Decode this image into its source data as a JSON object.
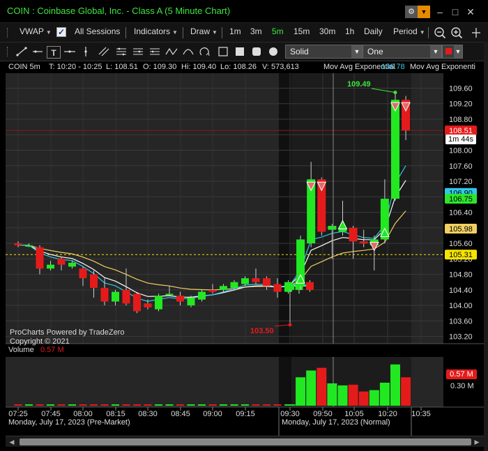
{
  "window": {
    "title": "COIN : Coinbase Global, Inc. - Class A (5 Minute Chart)"
  },
  "toolbar": {
    "vwap_label": "VWAP",
    "vwap_checked": true,
    "all_sessions_label": "All Sessions",
    "indicators_label": "Indicators",
    "draw_label": "Draw",
    "timeframes": [
      "1m",
      "3m",
      "5m",
      "15m",
      "30m",
      "1h",
      "Daily"
    ],
    "active_timeframe": "5m",
    "period_label": "Period"
  },
  "draw_toolbar": {
    "line_style": "Solid",
    "line_width": "One",
    "color": "#e51b1b"
  },
  "info_bar": {
    "symbol": "COIN 5m",
    "time": "T: 10:20 - 10:25",
    "last": "L: 108.51",
    "open": "O: 109.30",
    "high": "Hi: 109.40",
    "low": "Lo: 108.26",
    "volume": "V: 573,613",
    "ma1_label": "Mov Avg Exponential",
    "ma1_value": "106.78",
    "ma2_label": "Mov Avg Exponenti"
  },
  "chart": {
    "branding": "ProCharts Powered by TradeZero",
    "copyright": "Copyright © 2021",
    "high_marker": "109.49",
    "low_marker": "103.50",
    "volume_label": "Volume",
    "volume_value": "0.57 M",
    "volume_badge": "0.57 M",
    "volume_axis_label": "0.30 M",
    "countdown": "1m 44s",
    "date_premarket": "Monday, July 17, 2023 (Pre-Market)",
    "date_normal": "Monday, July 17, 2023 (Normal)",
    "price_badges": [
      {
        "text": "108.51",
        "bg": "#e51b1b",
        "fg": "#ffffff",
        "price": 108.51
      },
      {
        "text": "106.90",
        "bg": "#30c8e8",
        "fg": "#000000",
        "price": 106.9
      },
      {
        "text": "106.75",
        "bg": "#2ee52e",
        "fg": "#000000",
        "price": 106.75
      },
      {
        "text": "105.98",
        "bg": "#f0d060",
        "fg": "#000000",
        "price": 105.98
      },
      {
        "text": "105.31",
        "bg": "#f5e400",
        "fg": "#000000",
        "price": 105.31
      }
    ]
  },
  "chart_data": {
    "type": "candlestick",
    "price_axis": [
      "109.60",
      "109.20",
      "108.80",
      "108.40",
      "108.00",
      "107.60",
      "107.20",
      "106.80",
      "106.40",
      "106.00",
      "105.60",
      "105.20",
      "104.80",
      "104.40",
      "104.00",
      "103.60",
      "103.20"
    ],
    "ylim": [
      103.05,
      109.95
    ],
    "time_axis": [
      "07:25",
      "07:45",
      "08:00",
      "08:15",
      "08:30",
      "08:45",
      "09:00",
      "09:15",
      "09:30",
      "09:50",
      "10:05",
      "10:20",
      "10:35"
    ],
    "candles": [
      {
        "o": 105.6,
        "h": 105.65,
        "l": 105.5,
        "c": 105.55
      },
      {
        "o": 105.55,
        "h": 105.6,
        "l": 105.5,
        "c": 105.55
      },
      {
        "o": 105.5,
        "h": 105.55,
        "l": 104.8,
        "c": 104.95
      },
      {
        "o": 104.95,
        "h": 105.15,
        "l": 104.9,
        "c": 105.05
      },
      {
        "o": 105.2,
        "h": 105.25,
        "l": 104.9,
        "c": 105.05
      },
      {
        "o": 105.0,
        "h": 105.15,
        "l": 104.95,
        "c": 105.1
      },
      {
        "o": 104.95,
        "h": 105.0,
        "l": 104.5,
        "c": 104.7
      },
      {
        "o": 104.8,
        "h": 104.9,
        "l": 104.2,
        "c": 104.45
      },
      {
        "o": 104.45,
        "h": 104.7,
        "l": 104.0,
        "c": 104.1
      },
      {
        "o": 104.1,
        "h": 104.4,
        "l": 104.0,
        "c": 104.35
      },
      {
        "o": 104.4,
        "h": 104.95,
        "l": 104.0,
        "c": 104.05
      },
      {
        "o": 104.3,
        "h": 104.35,
        "l": 103.8,
        "c": 103.85
      },
      {
        "o": 104.05,
        "h": 104.15,
        "l": 103.9,
        "c": 103.95
      },
      {
        "o": 103.9,
        "h": 104.3,
        "l": 103.85,
        "c": 104.25
      },
      {
        "o": 104.3,
        "h": 104.5,
        "l": 104.25,
        "c": 104.3
      },
      {
        "o": 104.25,
        "h": 104.35,
        "l": 104.0,
        "c": 104.1
      },
      {
        "o": 104.0,
        "h": 104.25,
        "l": 103.95,
        "c": 104.2
      },
      {
        "o": 104.15,
        "h": 104.4,
        "l": 104.1,
        "c": 104.35
      },
      {
        "o": 104.4,
        "h": 104.55,
        "l": 104.3,
        "c": 104.35
      },
      {
        "o": 104.4,
        "h": 104.55,
        "l": 104.35,
        "c": 104.5
      },
      {
        "o": 104.45,
        "h": 104.65,
        "l": 104.4,
        "c": 104.6
      },
      {
        "o": 104.55,
        "h": 104.75,
        "l": 104.5,
        "c": 104.7
      },
      {
        "o": 104.7,
        "h": 104.95,
        "l": 104.55,
        "c": 104.6
      },
      {
        "o": 104.7,
        "h": 104.75,
        "l": 104.4,
        "c": 104.5
      },
      {
        "o": 104.55,
        "h": 104.7,
        "l": 104.2,
        "c": 104.35
      },
      {
        "o": 104.35,
        "h": 104.65,
        "l": 104.3,
        "c": 104.6
      },
      {
        "o": 104.4,
        "h": 104.7,
        "l": 104.3,
        "c": 104.65
      },
      {
        "o": 104.6,
        "h": 104.65,
        "l": 104.35,
        "c": 104.4
      },
      {
        "o": 104.4,
        "h": 104.55,
        "l": 103.5,
        "c": 104.55
      },
      {
        "o": 104.5,
        "h": 105.8,
        "l": 104.4,
        "c": 105.7
      },
      {
        "o": 105.6,
        "h": 107.7,
        "l": 105.5,
        "c": 107.25
      },
      {
        "o": 107.25,
        "h": 107.3,
        "l": 105.8,
        "c": 105.9
      },
      {
        "o": 105.95,
        "h": 106.1,
        "l": 105.2,
        "c": 106.05
      },
      {
        "o": 105.9,
        "h": 106.7,
        "l": 105.8,
        "c": 106.0
      },
      {
        "o": 106.0,
        "h": 106.05,
        "l": 105.2,
        "c": 105.65
      },
      {
        "o": 105.65,
        "h": 105.95,
        "l": 105.5,
        "c": 105.6
      },
      {
        "o": 105.55,
        "h": 105.8,
        "l": 104.9,
        "c": 105.7
      },
      {
        "o": 105.7,
        "h": 107.25,
        "l": 105.6,
        "c": 106.75
      },
      {
        "o": 106.75,
        "h": 109.49,
        "l": 106.7,
        "c": 109.3
      },
      {
        "o": 109.3,
        "h": 109.4,
        "l": 108.26,
        "c": 108.51
      }
    ],
    "sessions": [
      {
        "name": "Pre-Market",
        "start_time": "07:25"
      },
      {
        "name": "Normal",
        "start_time": "09:30"
      }
    ],
    "moving_averages": [
      {
        "name": "Mov Avg Exponential",
        "color": "#30c8e8",
        "last": 106.9
      },
      {
        "name": "Mov Avg Exponential",
        "color": "#ffffff",
        "last": 106.75
      },
      {
        "name": "VWAP",
        "color": "#f0d060",
        "last": 105.98
      }
    ],
    "reference_lines": [
      {
        "price": 105.31,
        "color": "#f5e400",
        "style": "dashed"
      },
      {
        "price": 108.51,
        "color": "#8a1a1a",
        "style": "solid"
      }
    ],
    "volume": [
      0.02,
      0.02,
      0.02,
      0.02,
      0.02,
      0.02,
      0.02,
      0.02,
      0.02,
      0.02,
      0.02,
      0.02,
      0.02,
      0.02,
      0.02,
      0.02,
      0.02,
      0.02,
      0.02,
      0.02,
      0.02,
      0.02,
      0.02,
      0.02,
      0.02,
      0.02,
      0.02,
      0.02,
      0.02,
      0.42,
      0.52,
      0.56,
      0.33,
      0.3,
      0.31,
      0.21,
      0.23,
      0.34,
      0.61,
      0.42
    ],
    "volume_max": 0.68,
    "signals_up": [
      29,
      33,
      37
    ],
    "signals_down": [
      30,
      31,
      36,
      38,
      39
    ]
  }
}
